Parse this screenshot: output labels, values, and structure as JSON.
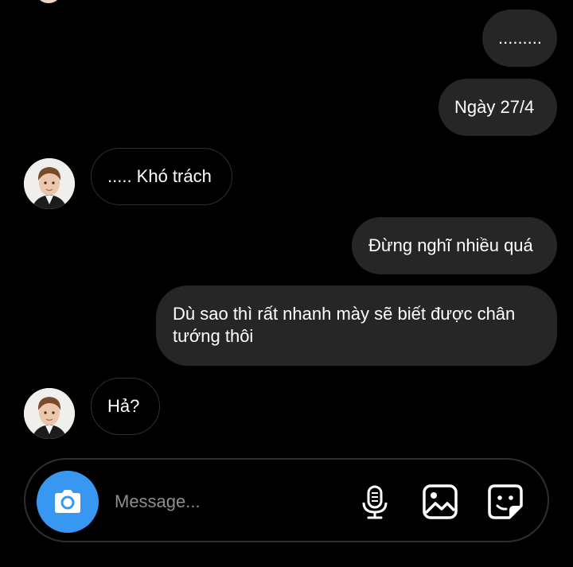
{
  "messages": [
    {
      "direction": "outgoing",
      "text": "........."
    },
    {
      "direction": "outgoing",
      "text": "Ngày 27/4"
    },
    {
      "direction": "incoming",
      "text": "..... Khó trách"
    },
    {
      "direction": "outgoing",
      "text": "Đừng nghĩ nhiều quá"
    },
    {
      "direction": "outgoing",
      "text": "Dù sao thì rất nhanh mày sẽ biết được chân tướng thôi"
    },
    {
      "direction": "incoming",
      "text": "Hả?"
    }
  ],
  "composer": {
    "placeholder": "Message...",
    "camera_icon": "camera-icon",
    "mic_icon": "microphone-icon",
    "gallery_icon": "image-icon",
    "sticker_icon": "sticker-icon"
  },
  "colors": {
    "background": "#000000",
    "outgoing_bubble": "#262626",
    "incoming_border": "#2f2f2f",
    "accent": "#3897f0",
    "placeholder": "#8e8e8e"
  }
}
